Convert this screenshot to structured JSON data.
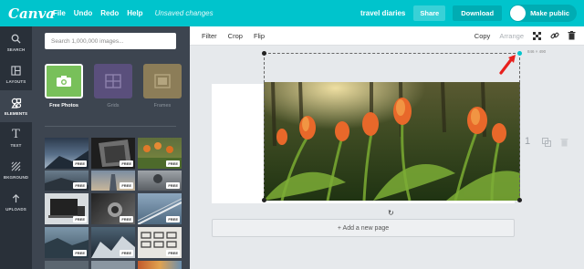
{
  "topbar": {
    "logo": "Canva",
    "menu": [
      "File",
      "Undo",
      "Redo",
      "Help"
    ],
    "status": "Unsaved changes",
    "doc_title": "travel diaries",
    "share": "Share",
    "download": "Download",
    "make_public": "Make public",
    "color": "#00c4cc"
  },
  "leftnav": [
    {
      "label": "SEARCH",
      "icon": "search-icon"
    },
    {
      "label": "LAYOUTS",
      "icon": "layouts-icon"
    },
    {
      "label": "ELEMENTS",
      "icon": "elements-icon",
      "active": true
    },
    {
      "label": "TEXT",
      "icon": "text-icon"
    },
    {
      "label": "BKGROUND",
      "icon": "background-icon"
    },
    {
      "label": "UPLOADS",
      "icon": "upload-icon"
    }
  ],
  "panel": {
    "search_placeholder": "Search 1,000,000 images...",
    "categories": [
      {
        "label": "Free Photos",
        "icon": "camera-icon",
        "active": true
      },
      {
        "label": "Grids",
        "icon": "grid-icon"
      },
      {
        "label": "Frames",
        "icon": "frame-icon"
      }
    ],
    "free_badge": "FREE"
  },
  "toolbar": {
    "filter": "Filter",
    "crop": "Crop",
    "flip": "Flip",
    "copy": "Copy",
    "arrange": "Arrange",
    "icons": [
      "transparency-icon",
      "link-icon",
      "trash-icon"
    ]
  },
  "canvas": {
    "size_label": "846 × 490",
    "page_number": "1",
    "add_page": "+ Add a new page"
  }
}
